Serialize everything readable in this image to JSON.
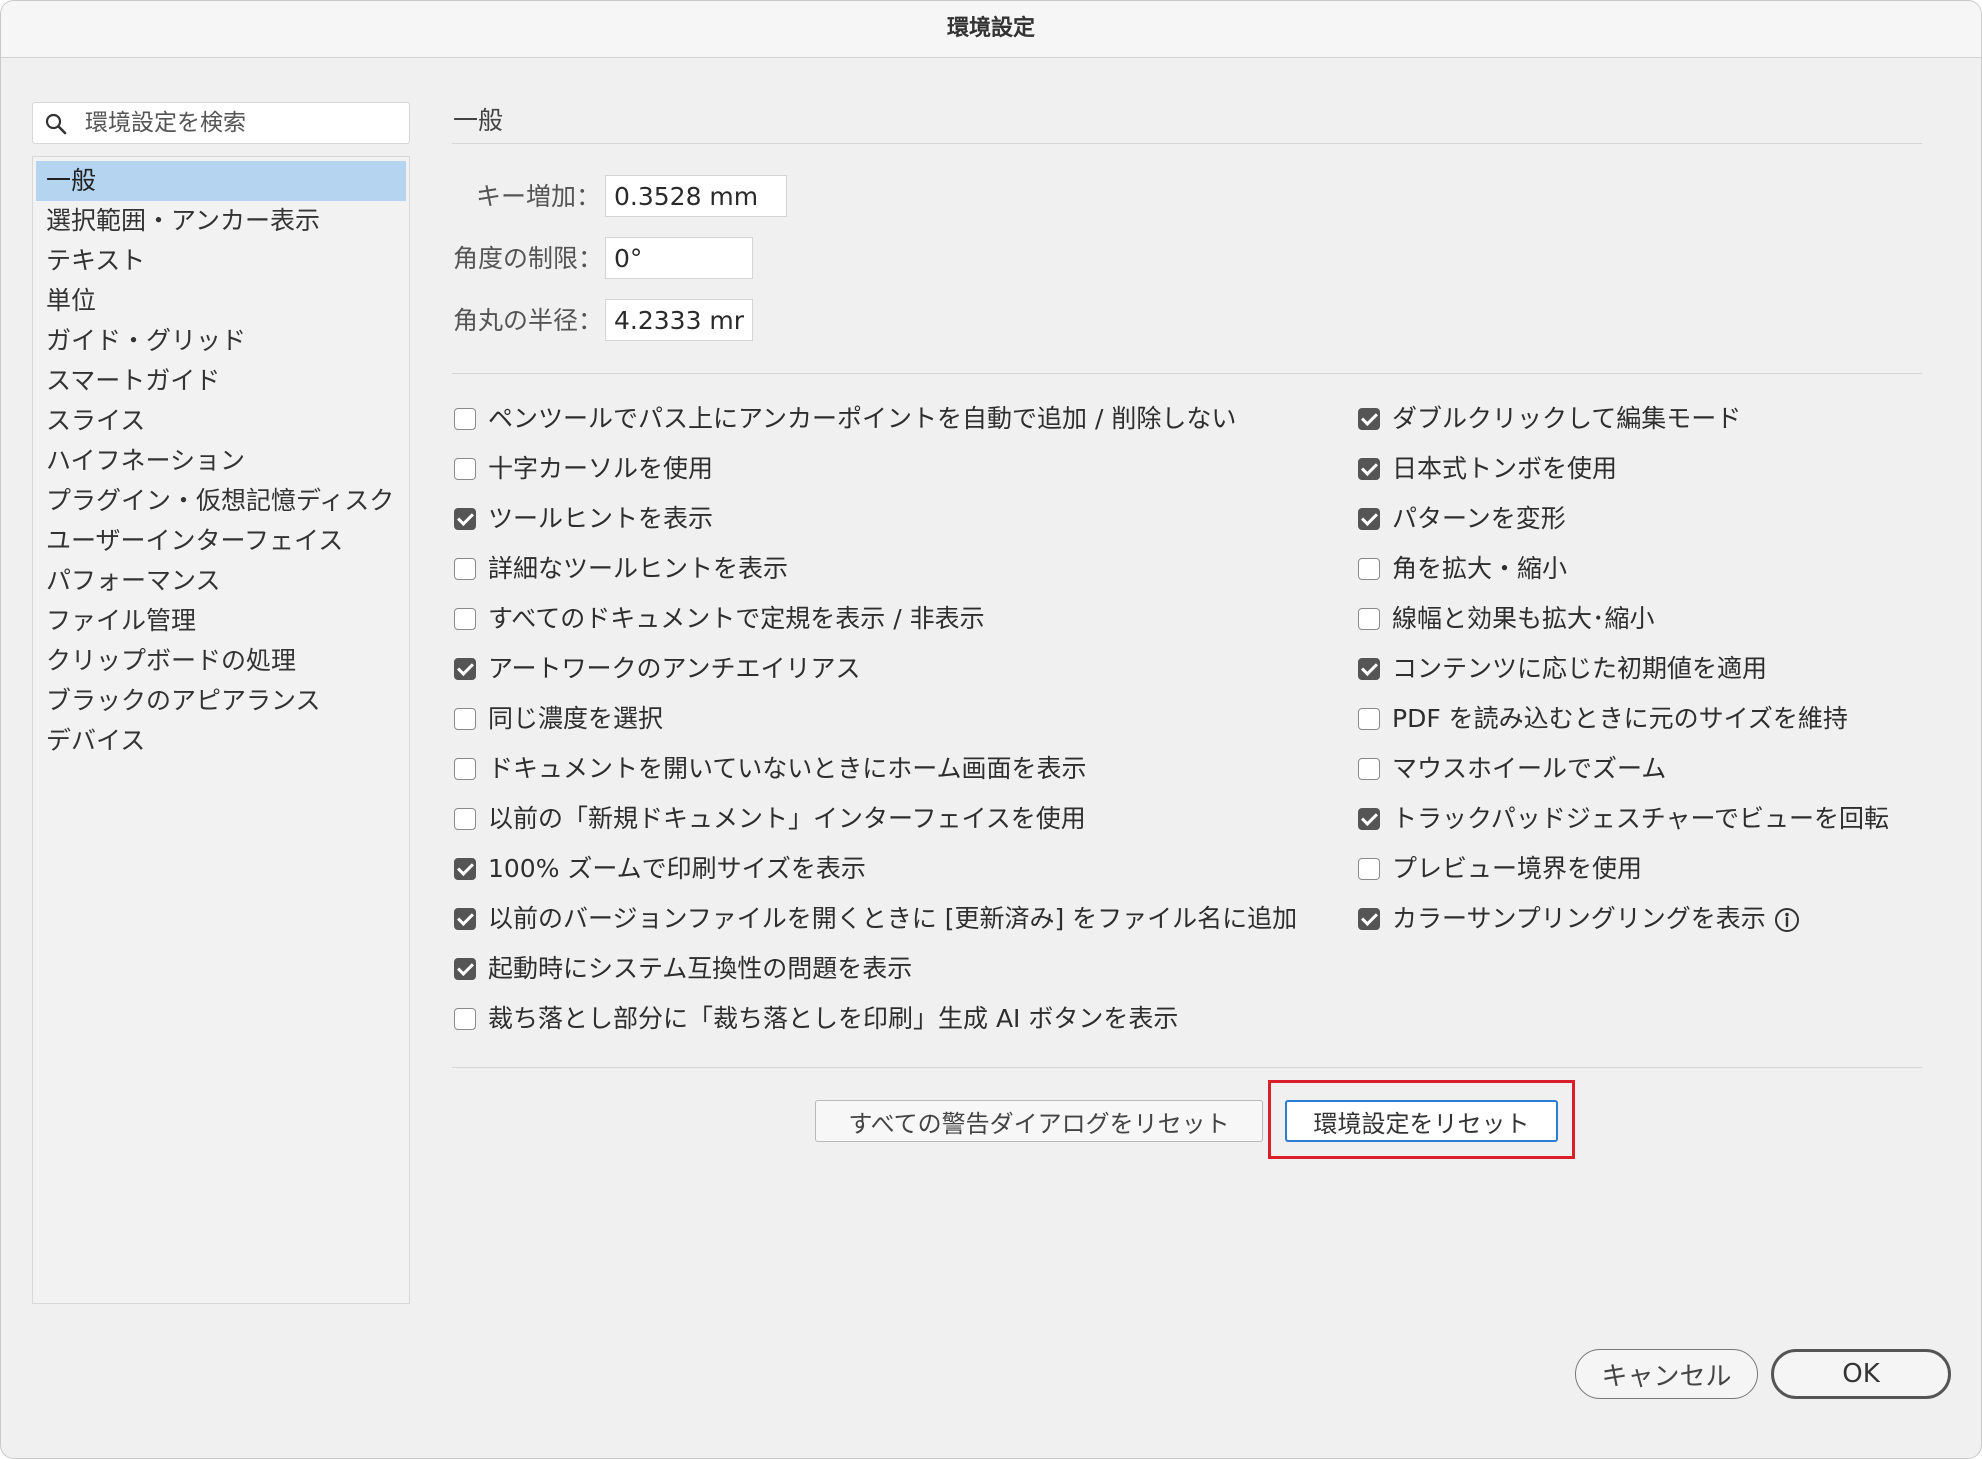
{
  "window": {
    "title": "環境設定"
  },
  "search": {
    "placeholder": "環境設定を検索",
    "value": ""
  },
  "sidebar": {
    "items": [
      {
        "label": "一般",
        "selected": true
      },
      {
        "label": "選択範囲・アンカー表示"
      },
      {
        "label": "テキスト"
      },
      {
        "label": "単位"
      },
      {
        "label": "ガイド・グリッド"
      },
      {
        "label": "スマートガイド"
      },
      {
        "label": "スライス"
      },
      {
        "label": "ハイフネーション"
      },
      {
        "label": "プラグイン・仮想記憶ディスク"
      },
      {
        "label": "ユーザーインターフェイス"
      },
      {
        "label": "パフォーマンス"
      },
      {
        "label": "ファイル管理"
      },
      {
        "label": "クリップボードの処理"
      },
      {
        "label": "ブラックのアピアランス"
      },
      {
        "label": "デバイス"
      }
    ]
  },
  "main": {
    "section_title": "一般",
    "fields": [
      {
        "label": "キー増加：",
        "value": "0.3528 mm"
      },
      {
        "label": "角度の制限：",
        "value": "0°"
      },
      {
        "label": "角丸の半径：",
        "value": "4.2333 mr"
      }
    ],
    "left_checks": [
      {
        "label": "ペンツールでパス上にアンカーポイントを自動で追加 / 削除しない",
        "checked": false
      },
      {
        "label": "十字カーソルを使用",
        "checked": false
      },
      {
        "label": "ツールヒントを表示",
        "checked": true
      },
      {
        "label": "詳細なツールヒントを表示",
        "checked": false
      },
      {
        "label": "すべてのドキュメントで定規を表示 / 非表示",
        "checked": false
      },
      {
        "label": "アートワークのアンチエイリアス",
        "checked": true
      },
      {
        "label": "同じ濃度を選択",
        "checked": false
      },
      {
        "label": "ドキュメントを開いていないときにホーム画面を表示",
        "checked": false
      },
      {
        "label": "以前の「新規ドキュメント」インターフェイスを使用",
        "checked": false
      },
      {
        "label": "100% ズームで印刷サイズを表示",
        "checked": true
      },
      {
        "label": "以前のバージョンファイルを開くときに [更新済み] をファイル名に追加",
        "checked": true
      },
      {
        "label": "起動時にシステム互換性の問題を表示",
        "checked": true
      },
      {
        "label": "裁ち落とし部分に「裁ち落としを印刷」生成 AI ボタンを表示",
        "checked": false
      }
    ],
    "right_checks": [
      {
        "label": "ダブルクリックして編集モード",
        "checked": true
      },
      {
        "label": "日本式トンボを使用",
        "checked": true
      },
      {
        "label": "パターンを変形",
        "checked": true
      },
      {
        "label": "角を拡大・縮小",
        "checked": false
      },
      {
        "label": "線幅と効果も拡大･縮小",
        "checked": false
      },
      {
        "label": "コンテンツに応じた初期値を適用",
        "checked": true
      },
      {
        "label": "PDF を読み込むときに元のサイズを維持",
        "checked": false
      },
      {
        "label": "マウスホイールでズーム",
        "checked": false
      },
      {
        "label": "トラックパッドジェスチャーでビューを回転",
        "checked": true
      },
      {
        "label": "プレビュー境界を使用",
        "checked": false
      },
      {
        "label": "カラーサンプリングリングを表示",
        "checked": true,
        "icon": "info-icon"
      }
    ],
    "reset_warnings_label": "すべての警告ダイアログをリセット",
    "reset_prefs_label": "環境設定をリセット"
  },
  "footer": {
    "cancel_label": "キャンセル",
    "ok_label": "OK"
  },
  "colors": {
    "selection": "#b4d4f0",
    "focus": "#2b7cd3",
    "highlight": "#d81f2a"
  }
}
